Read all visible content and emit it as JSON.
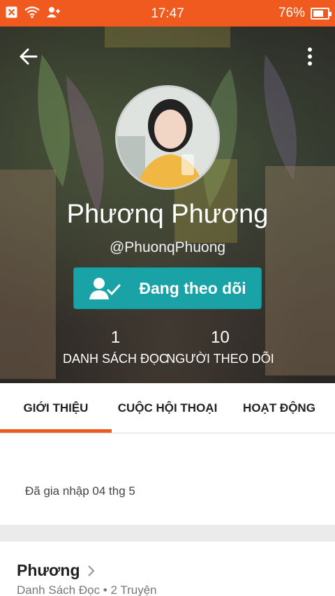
{
  "status_bar": {
    "time": "17:47",
    "battery_percent_label": "76%",
    "battery_level": 0.76,
    "icons": [
      "close-notification-icon",
      "wifi-icon",
      "add-person-icon"
    ]
  },
  "profile": {
    "display_name": "Phươnq Phương",
    "username": "@PhuonqPhuong",
    "follow_button_label": "Đang theo dõi",
    "stats": {
      "reading_lists": {
        "value": "1",
        "label": "DANH SÁCH ĐỌC"
      },
      "followers": {
        "value": "10",
        "label": "NGƯỜI THEO DÕI"
      }
    }
  },
  "tabs": [
    {
      "label": "GIỚI THIỆU",
      "active": true
    },
    {
      "label": "CUỘC HỘI THOẠI",
      "active": false
    },
    {
      "label": "HOẠT ĐỘNG",
      "active": false
    }
  ],
  "about": {
    "joined_text": "Đã gia nhập 04 thg 5"
  },
  "reading_list": {
    "title": "Phương",
    "subtitle": "Danh Sách Đọc • 2 Truyện"
  },
  "colors": {
    "accent": "#f05a1f",
    "follow_button": "#19a3a6"
  }
}
